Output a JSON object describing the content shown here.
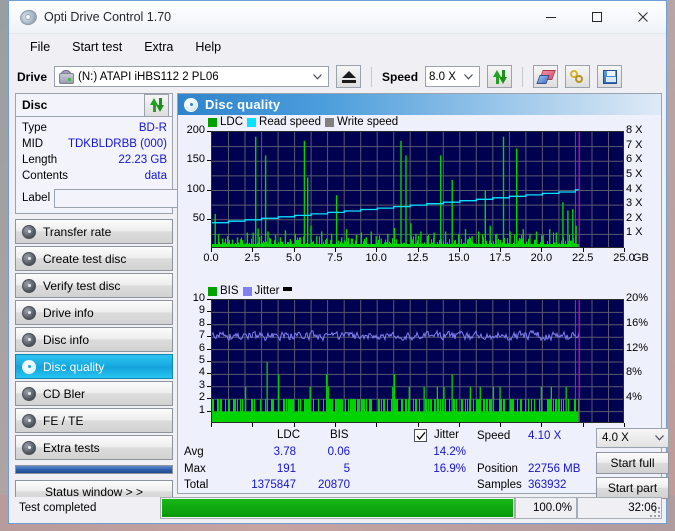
{
  "window": {
    "title": "Opti Drive Control 1.70",
    "icon": "optical-disc-icon",
    "minimize": "minimize-icon",
    "maximize": "maximize-icon",
    "close": "close-icon"
  },
  "menu": {
    "items": [
      "File",
      "Start test",
      "Extra",
      "Help"
    ]
  },
  "toolbar": {
    "drive_label": "Drive",
    "drive_value": "(N:)  ATAPI iHBS112  2 PL06",
    "eject_icon": "eject-icon",
    "speed_label": "Speed",
    "speed_value": "8.0 X",
    "refresh_icon": "refresh-arrows-icon",
    "erase_icon": "eraser-icon",
    "chain_icon": "chain-links-icon",
    "save_icon": "floppy-save-icon"
  },
  "disc": {
    "title": "Disc",
    "refresh_icon": "refresh-arrows-icon",
    "rows": [
      {
        "key": "Type",
        "value": "BD-R"
      },
      {
        "key": "MID",
        "value": "TDKBLDRBB (000)"
      },
      {
        "key": "Length",
        "value": "22.23 GB"
      },
      {
        "key": "Contents",
        "value": "data"
      }
    ],
    "label_key": "Label",
    "label_value": "",
    "label_placeholder": "",
    "cd_icon": "cd-disc-icon"
  },
  "nav": {
    "items": [
      {
        "label": "Transfer rate",
        "icon": "disc-transfer-icon",
        "active": false
      },
      {
        "label": "Create test disc",
        "icon": "disc-create-icon",
        "active": false
      },
      {
        "label": "Verify test disc",
        "icon": "disc-verify-icon",
        "active": false
      },
      {
        "label": "Drive info",
        "icon": "drive-info-icon",
        "active": false
      },
      {
        "label": "Disc info",
        "icon": "disc-info-icon",
        "active": false
      },
      {
        "label": "Disc quality",
        "icon": "disc-quality-icon",
        "active": true
      },
      {
        "label": "CD Bler",
        "icon": "disc-bler-icon",
        "active": false
      },
      {
        "label": "FE / TE",
        "icon": "disc-fete-icon",
        "active": false
      },
      {
        "label": "Extra tests",
        "icon": "disc-extra-icon",
        "active": false
      }
    ],
    "status_window": "Status window > >"
  },
  "panel": {
    "title": "Disc quality",
    "icon": "disc-quality-icon"
  },
  "chart_data": [
    {
      "id": "ldc-chart",
      "type": "line",
      "title": "LDC / Read speed",
      "legend": [
        {
          "label": "LDC",
          "color": "#00a000"
        },
        {
          "label": "Read speed",
          "color": "#00e5ff"
        },
        {
          "label": "Write speed",
          "color": "#808080"
        }
      ],
      "legend_position": "top-left",
      "grid": true,
      "xlabel": "GB",
      "xlim": [
        0,
        25
      ],
      "xticks": [
        0.0,
        2.5,
        5.0,
        7.5,
        10.0,
        12.5,
        15.0,
        17.5,
        20.0,
        22.5,
        25.0
      ],
      "xticklabels": [
        "0.0",
        "2.5",
        "5.0",
        "7.5",
        "10.0",
        "12.5",
        "15.0",
        "17.5",
        "20.0",
        "22.5",
        "25.0"
      ],
      "ylabel": "LDC",
      "ylim": [
        0,
        200
      ],
      "yticks": [
        50,
        100,
        150,
        200
      ],
      "yticklabels": [
        "50",
        "100",
        "150",
        "200"
      ],
      "y2label": "X",
      "y2lim": [
        0,
        8
      ],
      "y2ticks": [
        1,
        2,
        3,
        4,
        5,
        6,
        7,
        8
      ],
      "y2ticklabels": [
        "1 X",
        "2 X",
        "3 X",
        "4 X",
        "5 X",
        "6 X",
        "7 X",
        "8 X"
      ],
      "data_end_gb": 22.23,
      "marker_line_gb": 22.23,
      "marker_color": "#e000e0",
      "plot_bg": "#000050",
      "series": [
        {
          "name": "Read speed",
          "color": "#00e5ff",
          "type": "line",
          "x": [
            0.0,
            1.0,
            2.0,
            3.0,
            4.0,
            5.0,
            6.0,
            7.0,
            8.0,
            9.0,
            10.0,
            11.0,
            12.0,
            13.0,
            14.0,
            15.0,
            16.0,
            17.0,
            18.0,
            19.0,
            20.0,
            21.0,
            22.0,
            22.23
          ],
          "y_speed_x": [
            1.8,
            1.9,
            2.0,
            2.1,
            2.2,
            2.3,
            2.4,
            2.5,
            2.6,
            2.7,
            2.8,
            2.9,
            3.0,
            3.1,
            3.2,
            3.3,
            3.4,
            3.5,
            3.6,
            3.7,
            3.8,
            3.9,
            4.05,
            4.1
          ]
        },
        {
          "name": "LDC",
          "color": "#00d400",
          "type": "spikes",
          "baseline": 8,
          "spikes_gb_value": [
            [
              0.15,
              60
            ],
            [
              0.35,
              25
            ],
            [
              0.6,
              18
            ],
            [
              0.9,
              22
            ],
            [
              1.2,
              16
            ],
            [
              1.5,
              20
            ],
            [
              1.8,
              15
            ],
            [
              2.1,
              28
            ],
            [
              2.45,
              28
            ],
            [
              2.6,
              192
            ],
            [
              2.75,
              35
            ],
            [
              2.95,
              22
            ],
            [
              3.2,
              160
            ],
            [
              3.35,
              30
            ],
            [
              3.5,
              18
            ],
            [
              3.8,
              24
            ],
            [
              4.1,
              20
            ],
            [
              4.4,
              32
            ],
            [
              4.7,
              17
            ],
            [
              5.0,
              26
            ],
            [
              5.3,
              20
            ],
            [
              5.55,
              185
            ],
            [
              5.75,
              122
            ],
            [
              5.95,
              40
            ],
            [
              6.3,
              22
            ],
            [
              6.6,
              30
            ],
            [
              6.9,
              18
            ],
            [
              7.2,
              26
            ],
            [
              7.5,
              92
            ],
            [
              7.8,
              20
            ],
            [
              8.1,
              34
            ],
            [
              8.4,
              18
            ],
            [
              8.7,
              24
            ],
            [
              9.0,
              28
            ],
            [
              9.3,
              20
            ],
            [
              9.6,
              30
            ],
            [
              9.9,
              22
            ],
            [
              10.2,
              18
            ],
            [
              10.6,
              26
            ],
            [
              11.0,
              36
            ],
            [
              11.4,
              185
            ],
            [
              11.7,
              160
            ],
            [
              12.0,
              44
            ],
            [
              12.3,
              26
            ],
            [
              12.6,
              30
            ],
            [
              13.0,
              22
            ],
            [
              13.4,
              28
            ],
            [
              13.8,
              160
            ],
            [
              14.1,
              30
            ],
            [
              14.5,
              118
            ],
            [
              14.9,
              26
            ],
            [
              15.3,
              34
            ],
            [
              15.7,
              22
            ],
            [
              16.1,
              30
            ],
            [
              16.5,
              100
            ],
            [
              16.8,
              40
            ],
            [
              17.2,
              26
            ],
            [
              17.6,
              192
            ],
            [
              18.0,
              30
            ],
            [
              18.4,
              172
            ],
            [
              18.8,
              34
            ],
            [
              19.2,
              26
            ],
            [
              19.6,
              30
            ],
            [
              20.0,
              24
            ],
            [
              20.4,
              34
            ],
            [
              20.8,
              28
            ],
            [
              21.2,
              80
            ],
            [
              21.5,
              66
            ],
            [
              21.8,
              68
            ],
            [
              22.0,
              40
            ]
          ]
        }
      ]
    },
    {
      "id": "bis-jitter-chart",
      "type": "line",
      "title": "BIS / Jitter",
      "legend": [
        {
          "label": "BIS",
          "color": "#00a000"
        },
        {
          "label": "Jitter",
          "color": "#8080f0"
        },
        {
          "label": "",
          "color": "#000000"
        }
      ],
      "legend_position": "top-left",
      "grid": true,
      "xlabel": "GB",
      "xlim": [
        0,
        25
      ],
      "xticks": [
        0.0,
        2.5,
        5.0,
        7.5,
        10.0,
        12.5,
        15.0,
        17.5,
        20.0,
        22.5,
        25.0
      ],
      "xticklabels": [
        "0.0",
        "2.5",
        "5.0",
        "7.5",
        "10.0",
        "12.5",
        "15.0",
        "17.5",
        "20.0",
        "22.5",
        "25.0"
      ],
      "ylabel": "BIS",
      "ylim": [
        0,
        10
      ],
      "yticks": [
        1,
        2,
        3,
        4,
        5,
        6,
        7,
        8,
        9,
        10
      ],
      "yticklabels": [
        "1",
        "2",
        "3",
        "4",
        "5",
        "6",
        "7",
        "8",
        "9",
        "10"
      ],
      "y2label": "%",
      "y2lim": [
        0,
        20
      ],
      "y2ticks": [
        4,
        8,
        12,
        16,
        20
      ],
      "y2ticklabels": [
        "4%",
        "8%",
        "12%",
        "16%",
        "20%"
      ],
      "data_end_gb": 22.23,
      "marker_line_gb": 22.23,
      "marker_color": "#e000e0",
      "plot_bg": "#000050",
      "series": [
        {
          "name": "Jitter",
          "color": "#8080f0",
          "type": "line",
          "avg_pct": 14.2,
          "max_pct": 16.9,
          "band_pct": [
            13.4,
            15.4
          ]
        },
        {
          "name": "BIS",
          "color": "#00d400",
          "type": "spikes",
          "baseline": 1,
          "spikes_gb_value": [
            [
              3.3,
              5
            ],
            [
              4.0,
              4
            ],
            [
              6.9,
              4
            ],
            [
              11.0,
              4
            ],
            [
              14.5,
              4
            ],
            [
              2.0,
              3
            ],
            [
              5.9,
              3
            ],
            [
              7.0,
              3
            ],
            [
              10.9,
              3
            ],
            [
              11.9,
              3
            ],
            [
              12.8,
              3
            ],
            [
              13.6,
              3
            ],
            [
              14.0,
              3
            ],
            [
              15.6,
              3
            ],
            [
              16.2,
              3
            ],
            [
              17.0,
              3
            ],
            [
              17.4,
              3
            ],
            [
              19.9,
              3
            ],
            [
              20.5,
              3
            ],
            [
              21.4,
              3
            ]
          ]
        }
      ]
    }
  ],
  "stats": {
    "col_headers": [
      "LDC",
      "BIS"
    ],
    "row_labels": [
      "Avg",
      "Max",
      "Total"
    ],
    "ldc": {
      "avg": "3.78",
      "max": "191",
      "total": "1375847"
    },
    "bis": {
      "avg": "0.06",
      "max": "5",
      "total": "20870"
    },
    "jitter": {
      "label": "Jitter",
      "checked": true,
      "avg": "14.2%",
      "max": "16.9%"
    },
    "speed": {
      "label": "Speed",
      "value": "4.10 X"
    },
    "position": {
      "label": "Position",
      "value": "22756 MB"
    },
    "samples": {
      "label": "Samples",
      "value": "363932"
    },
    "speed_select": "4.0 X",
    "start_full": "Start full",
    "start_part": "Start part"
  },
  "statusbar": {
    "text": "Test completed",
    "progress_pct": 100.0,
    "progress_label": "100.0%",
    "elapsed": "32:06"
  },
  "colors": {
    "accent": "#2e83cc",
    "plot_bg": "#000050",
    "ldc_green": "#00d400",
    "read_speed": "#00e5ff",
    "jitter": "#8080f0",
    "marker": "#e000e0",
    "value_text": "#1414d0",
    "progress": "#0a9a0a"
  }
}
